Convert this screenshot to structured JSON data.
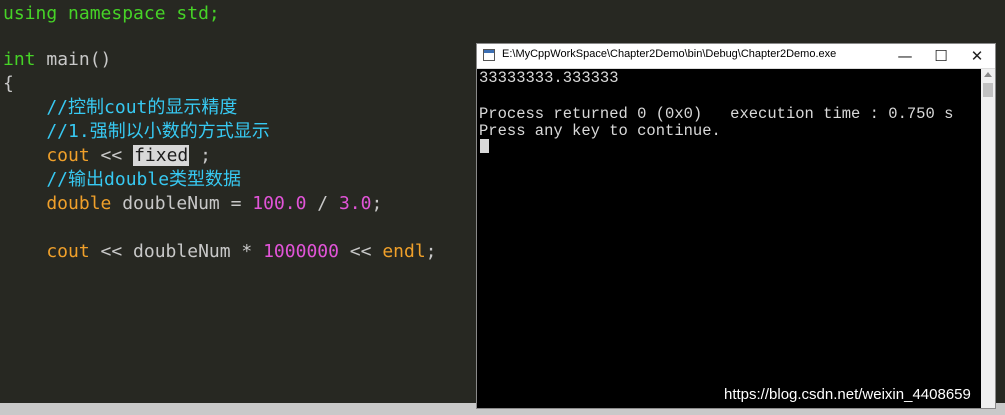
{
  "editor": {
    "lines": [
      [
        {
          "t": "using namespace std;",
          "c": "kw-green"
        }
      ],
      [],
      [
        {
          "t": "int",
          "c": "kw-green"
        },
        {
          "t": " main()",
          "c": "plain"
        }
      ],
      [
        {
          "t": "{",
          "c": "plain"
        }
      ],
      [
        {
          "t": "    //控制cout的显示精度",
          "c": "comment"
        }
      ],
      [
        {
          "t": "    //1.强制以小数的方式显示",
          "c": "comment"
        }
      ],
      [
        {
          "t": "    cout",
          "c": "orange"
        },
        {
          "t": " << ",
          "c": "plain"
        },
        {
          "t": "fixed",
          "c": "selected"
        },
        {
          "t": " ;",
          "c": "plain"
        }
      ],
      [
        {
          "t": "    //输出double类型数据",
          "c": "comment"
        }
      ],
      [
        {
          "t": "    double",
          "c": "orange"
        },
        {
          "t": " doubleNum = ",
          "c": "plain"
        },
        {
          "t": "100.0",
          "c": "number"
        },
        {
          "t": " / ",
          "c": "plain"
        },
        {
          "t": "3.0",
          "c": "number"
        },
        {
          "t": ";",
          "c": "plain"
        }
      ],
      [],
      [
        {
          "t": "    cout",
          "c": "orange"
        },
        {
          "t": " << doubleNum * ",
          "c": "plain"
        },
        {
          "t": "1000000",
          "c": "number"
        },
        {
          "t": " << ",
          "c": "plain"
        },
        {
          "t": "endl",
          "c": "orange"
        },
        {
          "t": ";",
          "c": "plain"
        }
      ]
    ],
    "colors": {
      "keyword": "#46d327",
      "comment": "#37c9f2",
      "number": "#e154d8",
      "type": "#f0a02a",
      "background": "#272822"
    }
  },
  "console": {
    "title": "E:\\MyCppWorkSpace\\Chapter2Demo\\bin\\Debug\\Chapter2Demo.exe",
    "minimize_symbol": "—",
    "maximize_symbol": "☐",
    "close_symbol": "✕",
    "output": [
      "33333333.333333",
      "",
      "Process returned 0 (0x0)   execution time : 0.750 s",
      "Press any key to continue."
    ],
    "icons": [
      "app-icon",
      "scroll-up-icon"
    ]
  },
  "watermark": "https://blog.csdn.net/weixin_4408659"
}
